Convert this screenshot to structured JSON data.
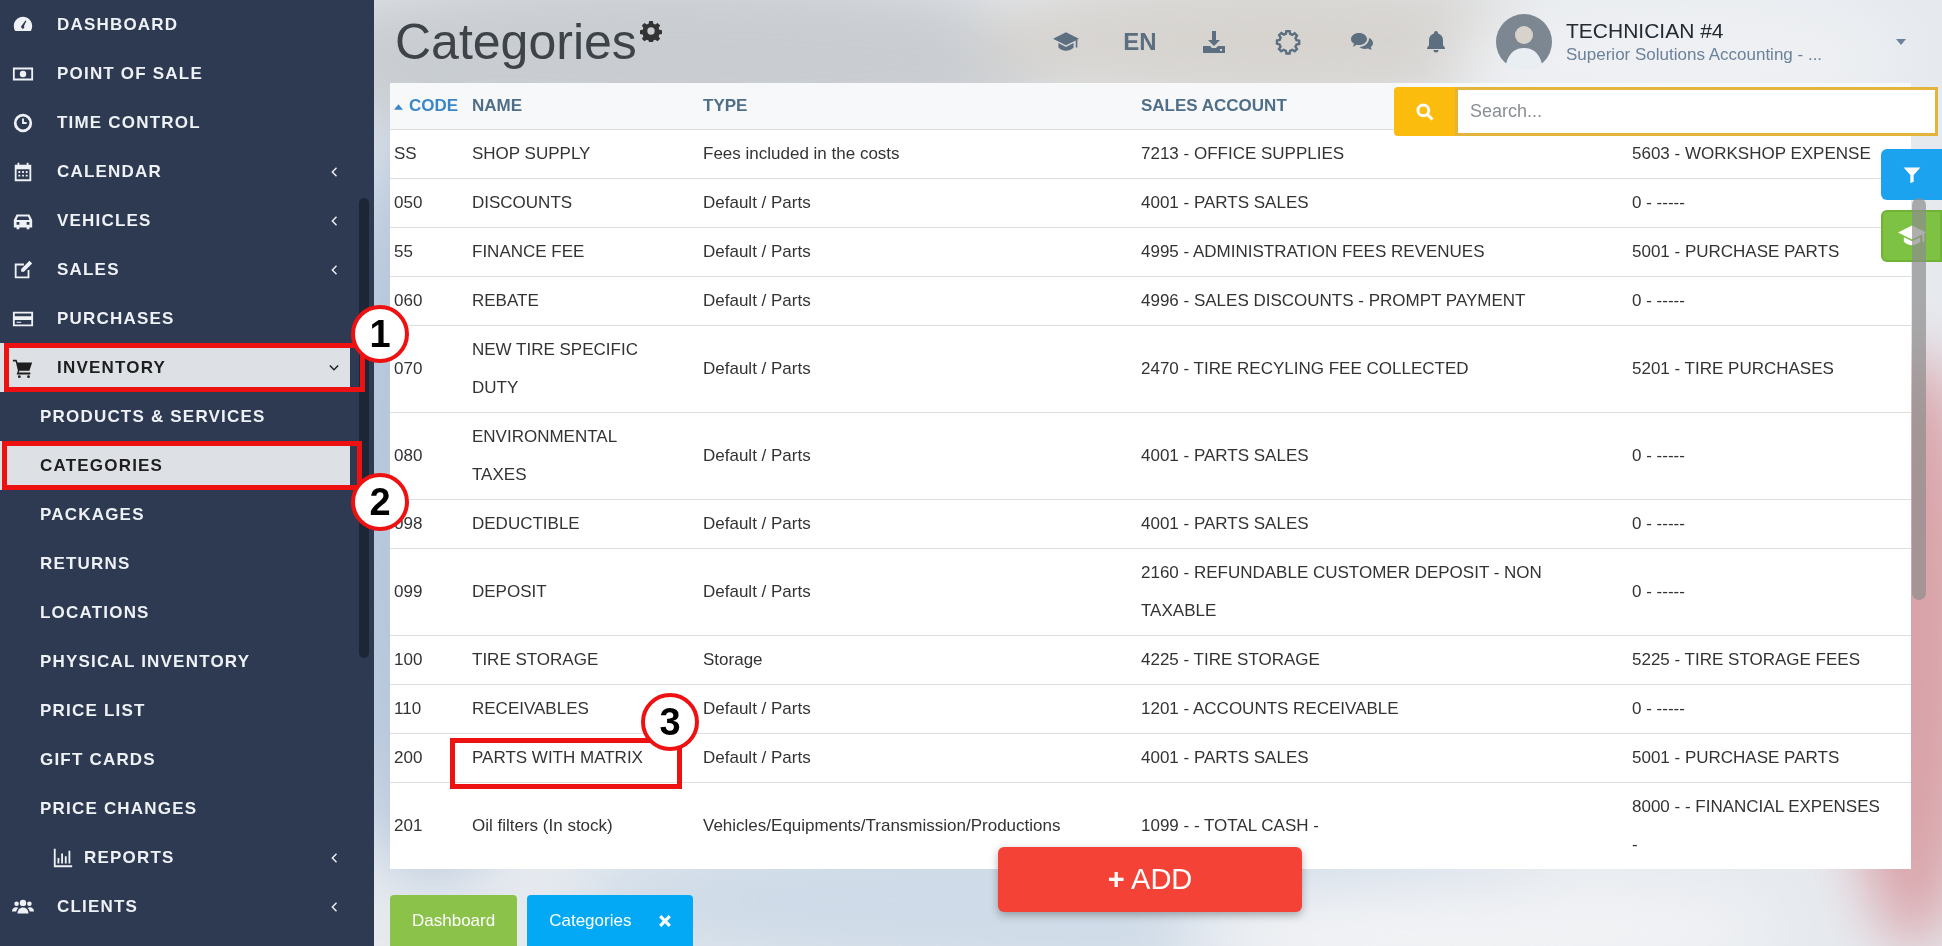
{
  "sidebar": {
    "items": [
      {
        "label": "DASHBOARD",
        "kind": "item",
        "selected": false
      },
      {
        "label": "POINT OF SALE",
        "kind": "item",
        "selected": false
      },
      {
        "label": "TIME CONTROL",
        "kind": "item",
        "selected": false
      },
      {
        "label": "CALENDAR",
        "kind": "item",
        "selected": false,
        "expanded": false
      },
      {
        "label": "VEHICLES",
        "kind": "item",
        "selected": false,
        "expanded": false
      },
      {
        "label": "SALES",
        "kind": "item",
        "selected": false,
        "expanded": false
      },
      {
        "label": "PURCHASES",
        "kind": "item",
        "selected": false
      },
      {
        "label": "INVENTORY",
        "kind": "item",
        "selected": true,
        "expanded": true
      },
      {
        "label": "PRODUCTS & SERVICES",
        "kind": "subitem",
        "selected": false
      },
      {
        "label": "CATEGORIES",
        "kind": "subitem",
        "selected": true
      },
      {
        "label": "PACKAGES",
        "kind": "subitem",
        "selected": false
      },
      {
        "label": "RETURNS",
        "kind": "subitem",
        "selected": false
      },
      {
        "label": "LOCATIONS",
        "kind": "subitem",
        "selected": false
      },
      {
        "label": "PHYSICAL INVENTORY",
        "kind": "subitem",
        "selected": false
      },
      {
        "label": "PRICE LIST",
        "kind": "subitem",
        "selected": false
      },
      {
        "label": "GIFT CARDS",
        "kind": "subitem",
        "selected": false
      },
      {
        "label": "PRICE CHANGES",
        "kind": "subitem",
        "selected": false
      },
      {
        "label": "REPORTS",
        "kind": "subgroup",
        "selected": false,
        "expanded": false
      },
      {
        "label": "CLIENTS",
        "kind": "item",
        "selected": false,
        "expanded": false
      }
    ]
  },
  "header": {
    "title": "Categories",
    "language": "EN",
    "user": {
      "name": "TECHNICIAN #4",
      "company": "Superior Solutions Accounting - ..."
    }
  },
  "search": {
    "placeholder": "Search..."
  },
  "table": {
    "columns": [
      {
        "label": "CODE",
        "sorted": true
      },
      {
        "label": "NAME",
        "sorted": false
      },
      {
        "label": "TYPE",
        "sorted": false
      },
      {
        "label": "SALES ACCOUNT",
        "sorted": false
      }
    ],
    "rows": [
      {
        "code": "SS",
        "name": "SHOP SUPPLY",
        "type": "Fees included in the costs",
        "sales_account": "7213 - OFFICE SUPPLIES",
        "column_5": "5603 - WORKSHOP EXPENSE"
      },
      {
        "code": "050",
        "name": "DISCOUNTS",
        "type": "Default / Parts",
        "sales_account": "4001 - PARTS SALES",
        "column_5": "0 - -----"
      },
      {
        "code": "55",
        "name": "FINANCE FEE",
        "type": "Default / Parts",
        "sales_account": "4995 - ADMINISTRATION FEES REVENUES",
        "column_5": "5001 - PURCHASE PARTS"
      },
      {
        "code": "060",
        "name": "REBATE",
        "type": "Default / Parts",
        "sales_account": "4996 - SALES DISCOUNTS - PROMPT PAYMENT",
        "column_5": "0 - -----"
      },
      {
        "code": "070",
        "name": "NEW TIRE SPECIFIC DUTY",
        "type": "Default / Parts",
        "sales_account": "2470 - TIRE RECYLING FEE COLLECTED",
        "column_5": "5201 - TIRE PURCHASES"
      },
      {
        "code": "080",
        "name": "ENVIRONMENTAL TAXES",
        "type": "Default / Parts",
        "sales_account": "4001 - PARTS SALES",
        "column_5": "0 - -----"
      },
      {
        "code": "098",
        "name": "DEDUCTIBLE",
        "type": "Default / Parts",
        "sales_account": "4001 - PARTS SALES",
        "column_5": "0 - -----"
      },
      {
        "code": "099",
        "name": "DEPOSIT",
        "type": "Default / Parts",
        "sales_account": "2160 - REFUNDABLE CUSTOMER DEPOSIT - NON TAXABLE",
        "column_5": "0 - -----"
      },
      {
        "code": "100",
        "name": "TIRE STORAGE",
        "type": "Storage",
        "sales_account": "4225 - TIRE STORAGE",
        "column_5": "5225 - TIRE STORAGE FEES"
      },
      {
        "code": "110",
        "name": "RECEIVABLES",
        "type": "Default / Parts",
        "sales_account": "1201 - ACCOUNTS RECEIVABLE",
        "column_5": "0 - -----"
      },
      {
        "code": "200",
        "name": "PARTS WITH MATRIX",
        "type": "Default / Parts",
        "sales_account": "4001 - PARTS SALES",
        "column_5": "5001 - PURCHASE PARTS"
      },
      {
        "code": "201",
        "name": "Oil filters (In stock)",
        "type": "Vehicles/Equipments/Transmission/Productions",
        "sales_account": "1099 - - TOTAL CASH -",
        "column_5": "8000 - - FINANCIAL EXPENSES -"
      }
    ]
  },
  "add_button": {
    "label": "**+** ADD"
  },
  "bottom_tabs": [
    {
      "label": "Dashboard",
      "color": "#8bc34a",
      "closable": false
    },
    {
      "label": "Categories",
      "color": "#03a9f4",
      "closable": true
    }
  ],
  "annotations": [
    {
      "label": "1"
    },
    {
      "label": "2"
    },
    {
      "label": "3"
    }
  ]
}
